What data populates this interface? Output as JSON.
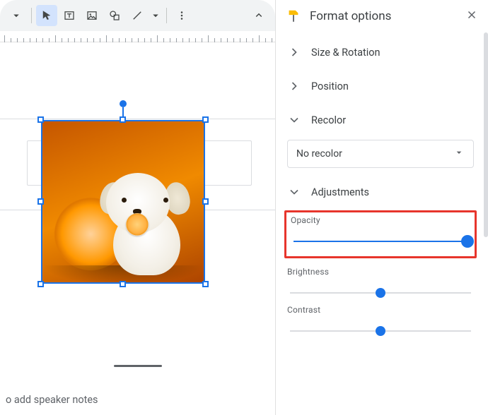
{
  "toolbar": {
    "tooltips": {
      "more_undo": "More",
      "select": "Select",
      "textbox": "Text box",
      "image": "Image",
      "shape": "Shape",
      "line": "Line",
      "line_more": "More line options",
      "more": "More",
      "collapse": "Hide the menus"
    }
  },
  "canvas": {
    "speaker_notes_placeholder": "o add speaker notes",
    "selected_image_alt": "White fluffy dog holding an orange slice next to a whole orange on an orange background"
  },
  "sidebar": {
    "title": "Format options",
    "sections": {
      "size_rotation": {
        "label": "Size & Rotation",
        "expanded": false
      },
      "position": {
        "label": "Position",
        "expanded": false
      },
      "recolor": {
        "label": "Recolor",
        "expanded": true,
        "select_value": "No recolor"
      },
      "adjustments": {
        "label": "Adjustments",
        "expanded": true
      }
    },
    "adjustments": {
      "opacity": {
        "label": "Opacity",
        "value": 100,
        "min": 0,
        "max": 100
      },
      "brightness": {
        "label": "Brightness",
        "value": 0,
        "min": -100,
        "max": 100
      },
      "contrast": {
        "label": "Contrast",
        "value": 0,
        "min": -100,
        "max": 100
      }
    }
  },
  "colors": {
    "accent": "#1a73e8",
    "highlight_box": "#e7352c"
  }
}
